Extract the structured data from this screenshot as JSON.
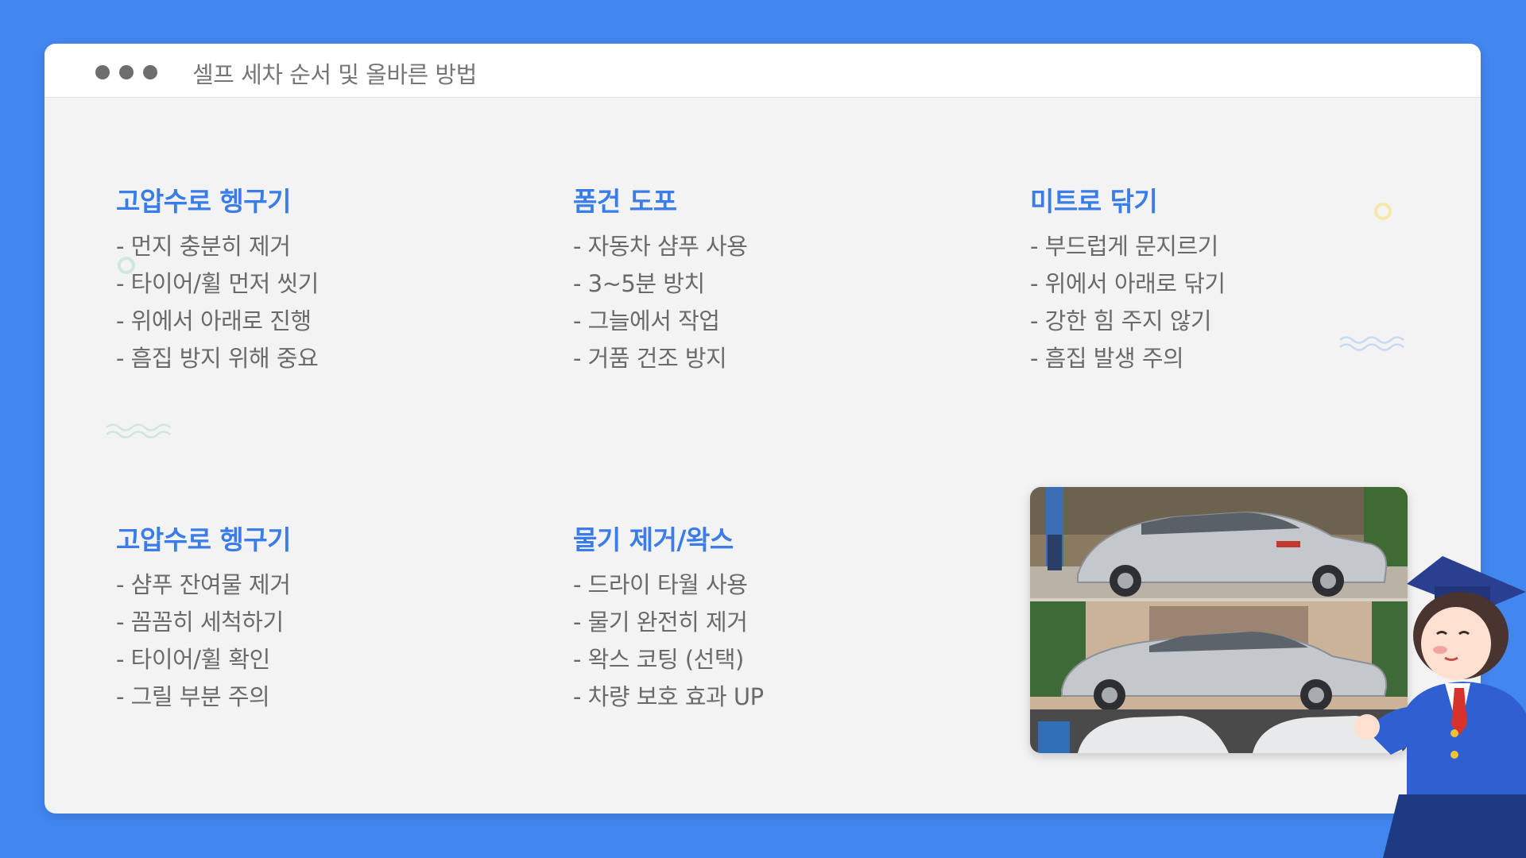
{
  "window": {
    "title": "셀프 세차 순서 및 올바른 방법"
  },
  "blocks": [
    {
      "title": "고압수로 헹구기",
      "items": [
        "- 먼지 충분히 제거",
        "- 타이어/휠 먼저 씻기",
        "- 위에서 아래로 진행",
        "- 흠집 방지 위해 중요"
      ]
    },
    {
      "title": "폼건 도포",
      "items": [
        "- 자동차 샴푸 사용",
        "- 3~5분 방치",
        "- 그늘에서 작업",
        "- 거품 건조 방지"
      ]
    },
    {
      "title": "미트로 닦기",
      "items": [
        "- 부드럽게 문지르기",
        "- 위에서 아래로 닦기",
        "- 강한 힘 주지 않기",
        "- 흠집 발생 주의"
      ]
    },
    {
      "title": "고압수로 헹구기",
      "items": [
        "- 샴푸 잔여물 제거",
        "- 꼼꼼히 세척하기",
        "- 타이어/휠 확인",
        "- 그릴 부분 주의"
      ]
    },
    {
      "title": "물기 제거/왁스",
      "items": [
        "- 드라이 타월 사용",
        "- 물기 완전히 제거",
        "- 왁스 코팅 (선택)",
        "- 차량 보호 효과 UP"
      ]
    }
  ],
  "colors": {
    "background": "#4286f0",
    "accent": "#3a7ce8",
    "body_text": "#6a6a6a",
    "window_bg": "#f3f3f3",
    "car_silver": "#c4c7cc"
  },
  "icons": {
    "window_controls": "window-control-dot",
    "photo": "car-wash-photo",
    "mascot": "graduate-girl-character"
  }
}
